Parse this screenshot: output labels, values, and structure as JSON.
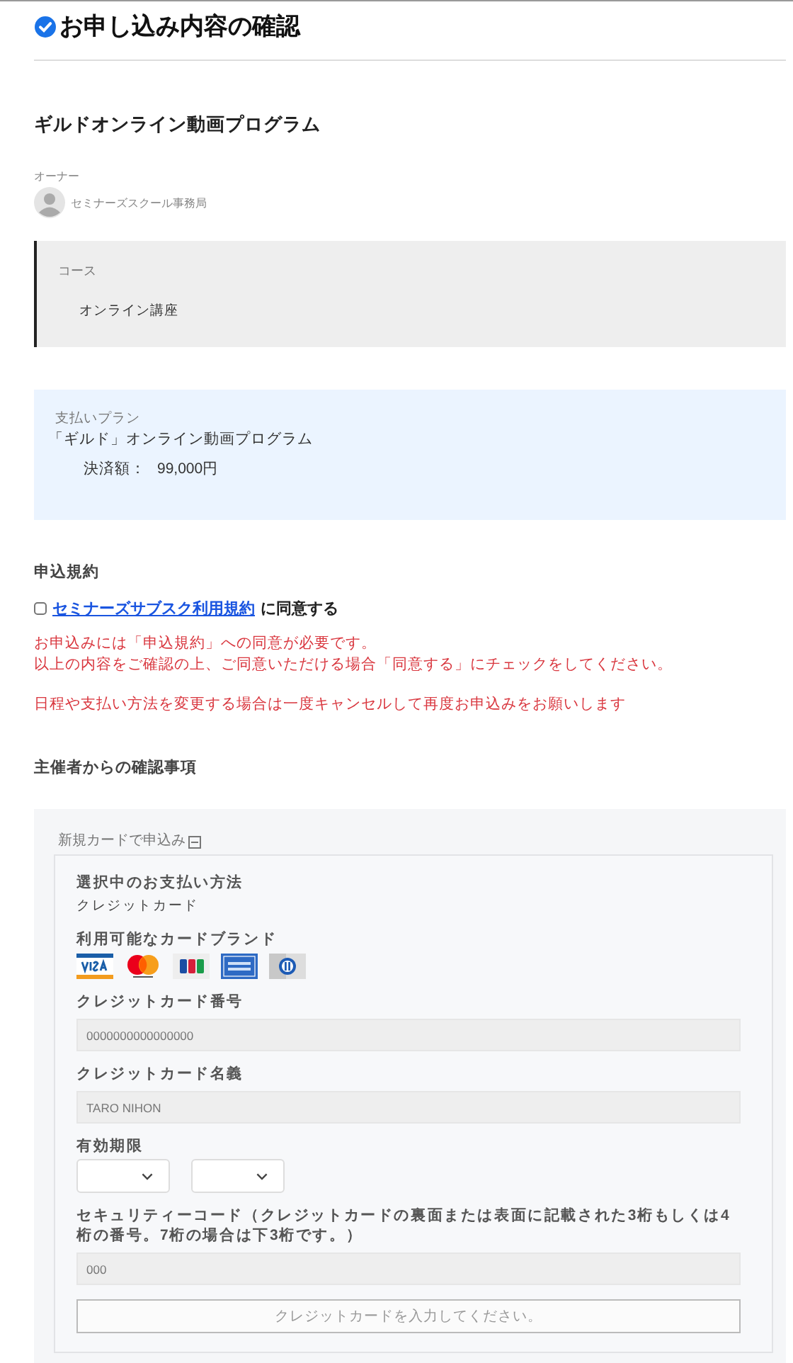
{
  "page_title": "お申し込み内容の確認",
  "program": {
    "title": "ギルドオンライン動画プログラム",
    "owner_label": "オーナー",
    "owner_name": "セミナーズスクール事務局"
  },
  "course": {
    "label": "コース",
    "value": "オンライン講座"
  },
  "plan": {
    "label": "支払いプラン",
    "name": "「ギルド」オンライン動画プログラム",
    "amount_label": "決済額：",
    "amount": "99,000円"
  },
  "terms": {
    "heading": "申込規約",
    "checked": false,
    "link": "セミナーズサブスク利用規約",
    "agree_text": "に同意する",
    "notices": [
      "お申込みには「申込規約」への同意が必要です。",
      "以上の内容をご確認の上、ご同意いただける場合「同意する」にチェックをしてください。"
    ],
    "change_notice": "日程や支払い方法を変更する場合は一度キャンセルして再度お申込みをお願いします"
  },
  "organizer": {
    "heading": "主催者からの確認事項"
  },
  "payment": {
    "toggle_label": "新規カードで申込み",
    "expanded": true,
    "method_label": "選択中のお支払い方法",
    "method": "クレジットカード",
    "brands_label": "利用可能なカードブランド",
    "brands": [
      {
        "kind": "visa"
      },
      {
        "kind": "mastercard"
      },
      {
        "kind": "jcb"
      },
      {
        "kind": "amex"
      },
      {
        "kind": "diners"
      }
    ],
    "fields": [
      {
        "kind": "text",
        "label": "クレジットカード番号",
        "placeholder": "0000000000000000"
      },
      {
        "kind": "text",
        "label": "クレジットカード名義",
        "placeholder": "TARO NIHON"
      },
      {
        "kind": "expiry",
        "label": "有効期限"
      },
      {
        "kind": "text",
        "label": "セキュリティーコード（クレジットカードの裏面または表面に記載された3桁もしくは4桁の番号。7桁の場合は下3桁です。）",
        "placeholder": "000"
      }
    ],
    "submit": {
      "label": "クレジットカードを入力してください。",
      "disabled": true
    }
  }
}
